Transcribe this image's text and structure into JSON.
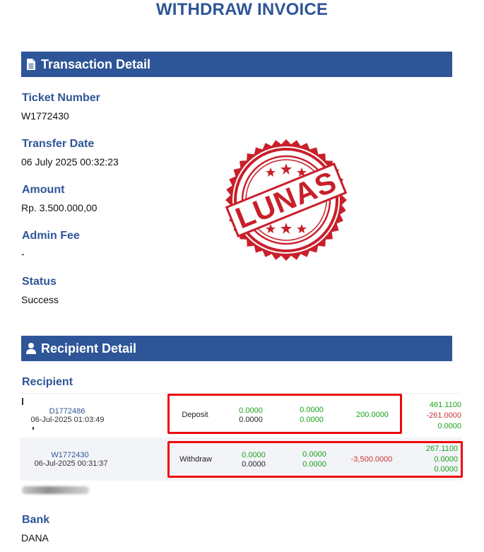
{
  "page": {
    "title": "WITHDRAW INVOICE"
  },
  "transaction": {
    "section_title": "Transaction Detail",
    "fields": [
      {
        "label": "Ticket Number",
        "value": "W1772430"
      },
      {
        "label": "Transfer Date",
        "value": "06 July 2025 00:32:23"
      },
      {
        "label": "Amount",
        "value": "Rp. 3.500.000,00"
      },
      {
        "label": "Admin Fee",
        "value": "-"
      },
      {
        "label": "Status",
        "value": "Success"
      }
    ]
  },
  "stamp": {
    "text": "LUNAS",
    "color": "#c8202a"
  },
  "recipient": {
    "section_title": "Recipient Detail",
    "label": "Recipient",
    "rows": [
      {
        "id": "D1772486",
        "date": "06-Jul-2025 01:03:49",
        "type": "Deposit",
        "col1": [
          "0.0000",
          "0.0000"
        ],
        "col2": [
          "0.0000",
          "0.0000"
        ],
        "amount": "200.0000",
        "balances": [
          "461.1100",
          "-261.0000",
          "0.0000"
        ]
      },
      {
        "id": "W1772430",
        "date": "06-Jul-2025 00:31:37",
        "type": "Withdraw",
        "col1": [
          "0.0000",
          "0.0000"
        ],
        "col2": [
          "0.0000",
          "0.0000"
        ],
        "amount": "-3,500.0000",
        "balances": [
          "267.1100",
          "0.0000",
          "0.0000"
        ]
      }
    ]
  },
  "bank": {
    "label": "Bank",
    "value": "DANA"
  },
  "colors": {
    "accent": "#2e5597",
    "highlight": "#ee0a0a",
    "positive": "#1aa31a",
    "negative": "#c83232"
  }
}
